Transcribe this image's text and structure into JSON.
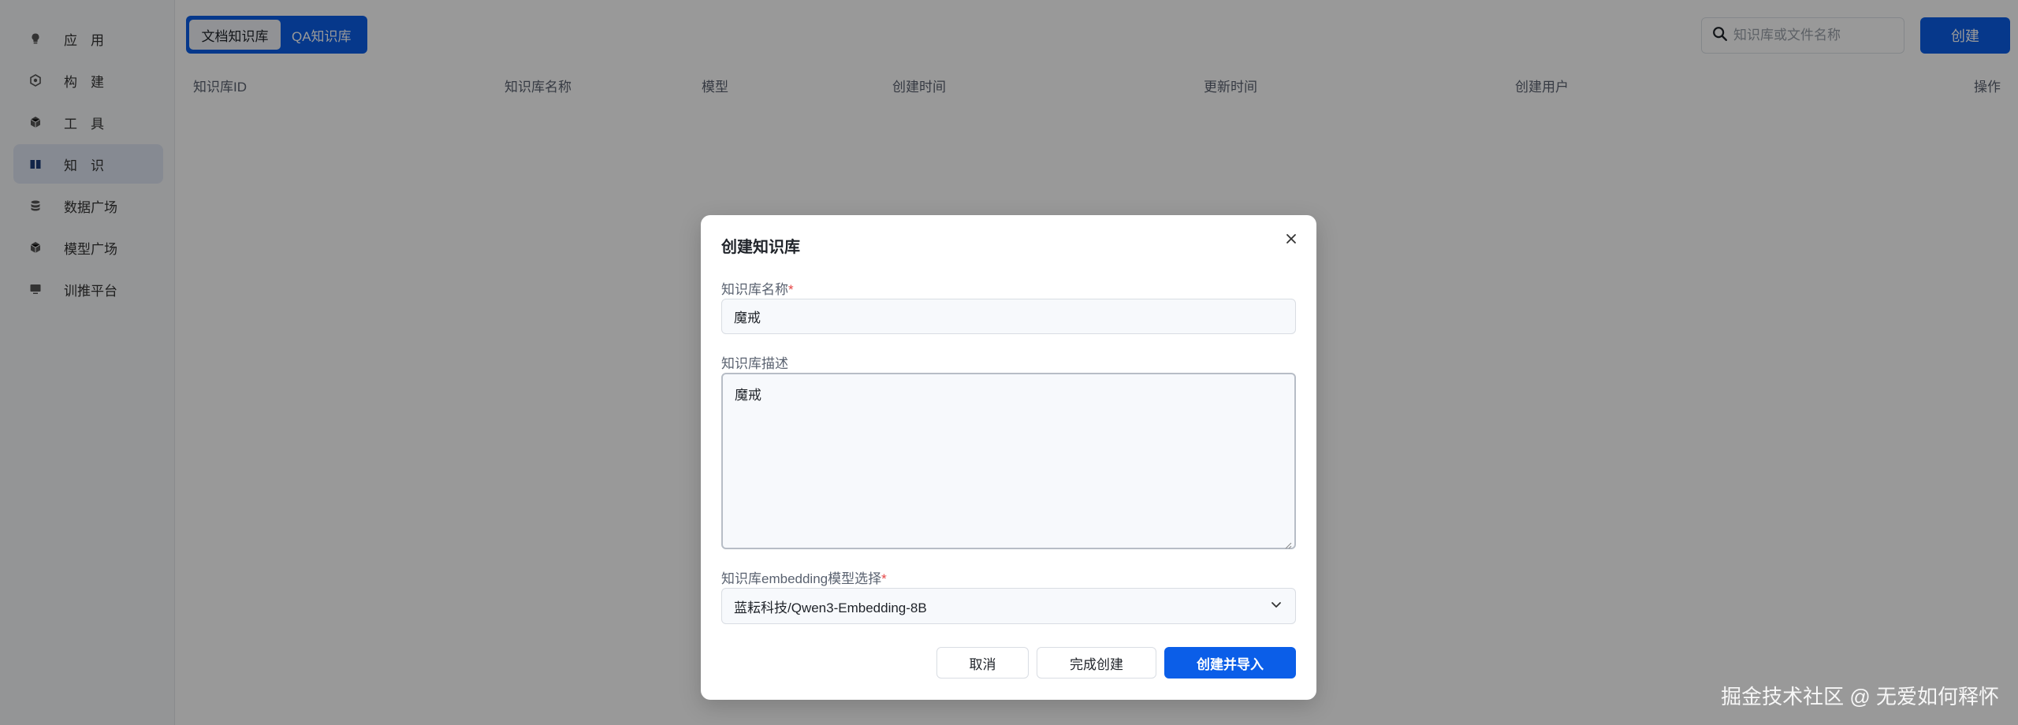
{
  "sidebar": {
    "items": [
      {
        "label": "应　用",
        "icon": "lightbulb-icon"
      },
      {
        "label": "构　建",
        "icon": "gear-icon"
      },
      {
        "label": "工　具",
        "icon": "cube-icon"
      },
      {
        "label": "知　识",
        "icon": "book-icon",
        "active": true
      },
      {
        "label": "数据广场",
        "icon": "database-icon"
      },
      {
        "label": "模型广场",
        "icon": "cube-icon"
      },
      {
        "label": "训推平台",
        "icon": "monitor-icon"
      }
    ]
  },
  "header": {
    "tabs": [
      {
        "label": "文档知识库",
        "active": true
      },
      {
        "label": "QA知识库",
        "active": false
      }
    ],
    "search_placeholder": "知识库或文件名称",
    "create_label": "创建"
  },
  "table": {
    "columns": [
      "知识库ID",
      "知识库名称",
      "模型",
      "创建时间",
      "更新时间",
      "创建用户",
      "操作"
    ]
  },
  "modal": {
    "title": "创建知识库",
    "name_label": "知识库名称",
    "name_value": "魔戒",
    "desc_label": "知识库描述",
    "desc_value": "魔戒",
    "model_label": "知识库embedding模型选择",
    "model_value": "蓝耘科技/Qwen3-Embedding-8B",
    "required_mark": "*",
    "cancel_label": "取消",
    "finish_label": "完成创建",
    "import_label": "创建并导入"
  },
  "watermark": "掘金技术社区 @ 无爱如何释怀",
  "colors": {
    "accent": "#0b5ee8",
    "required": "#e54545"
  }
}
